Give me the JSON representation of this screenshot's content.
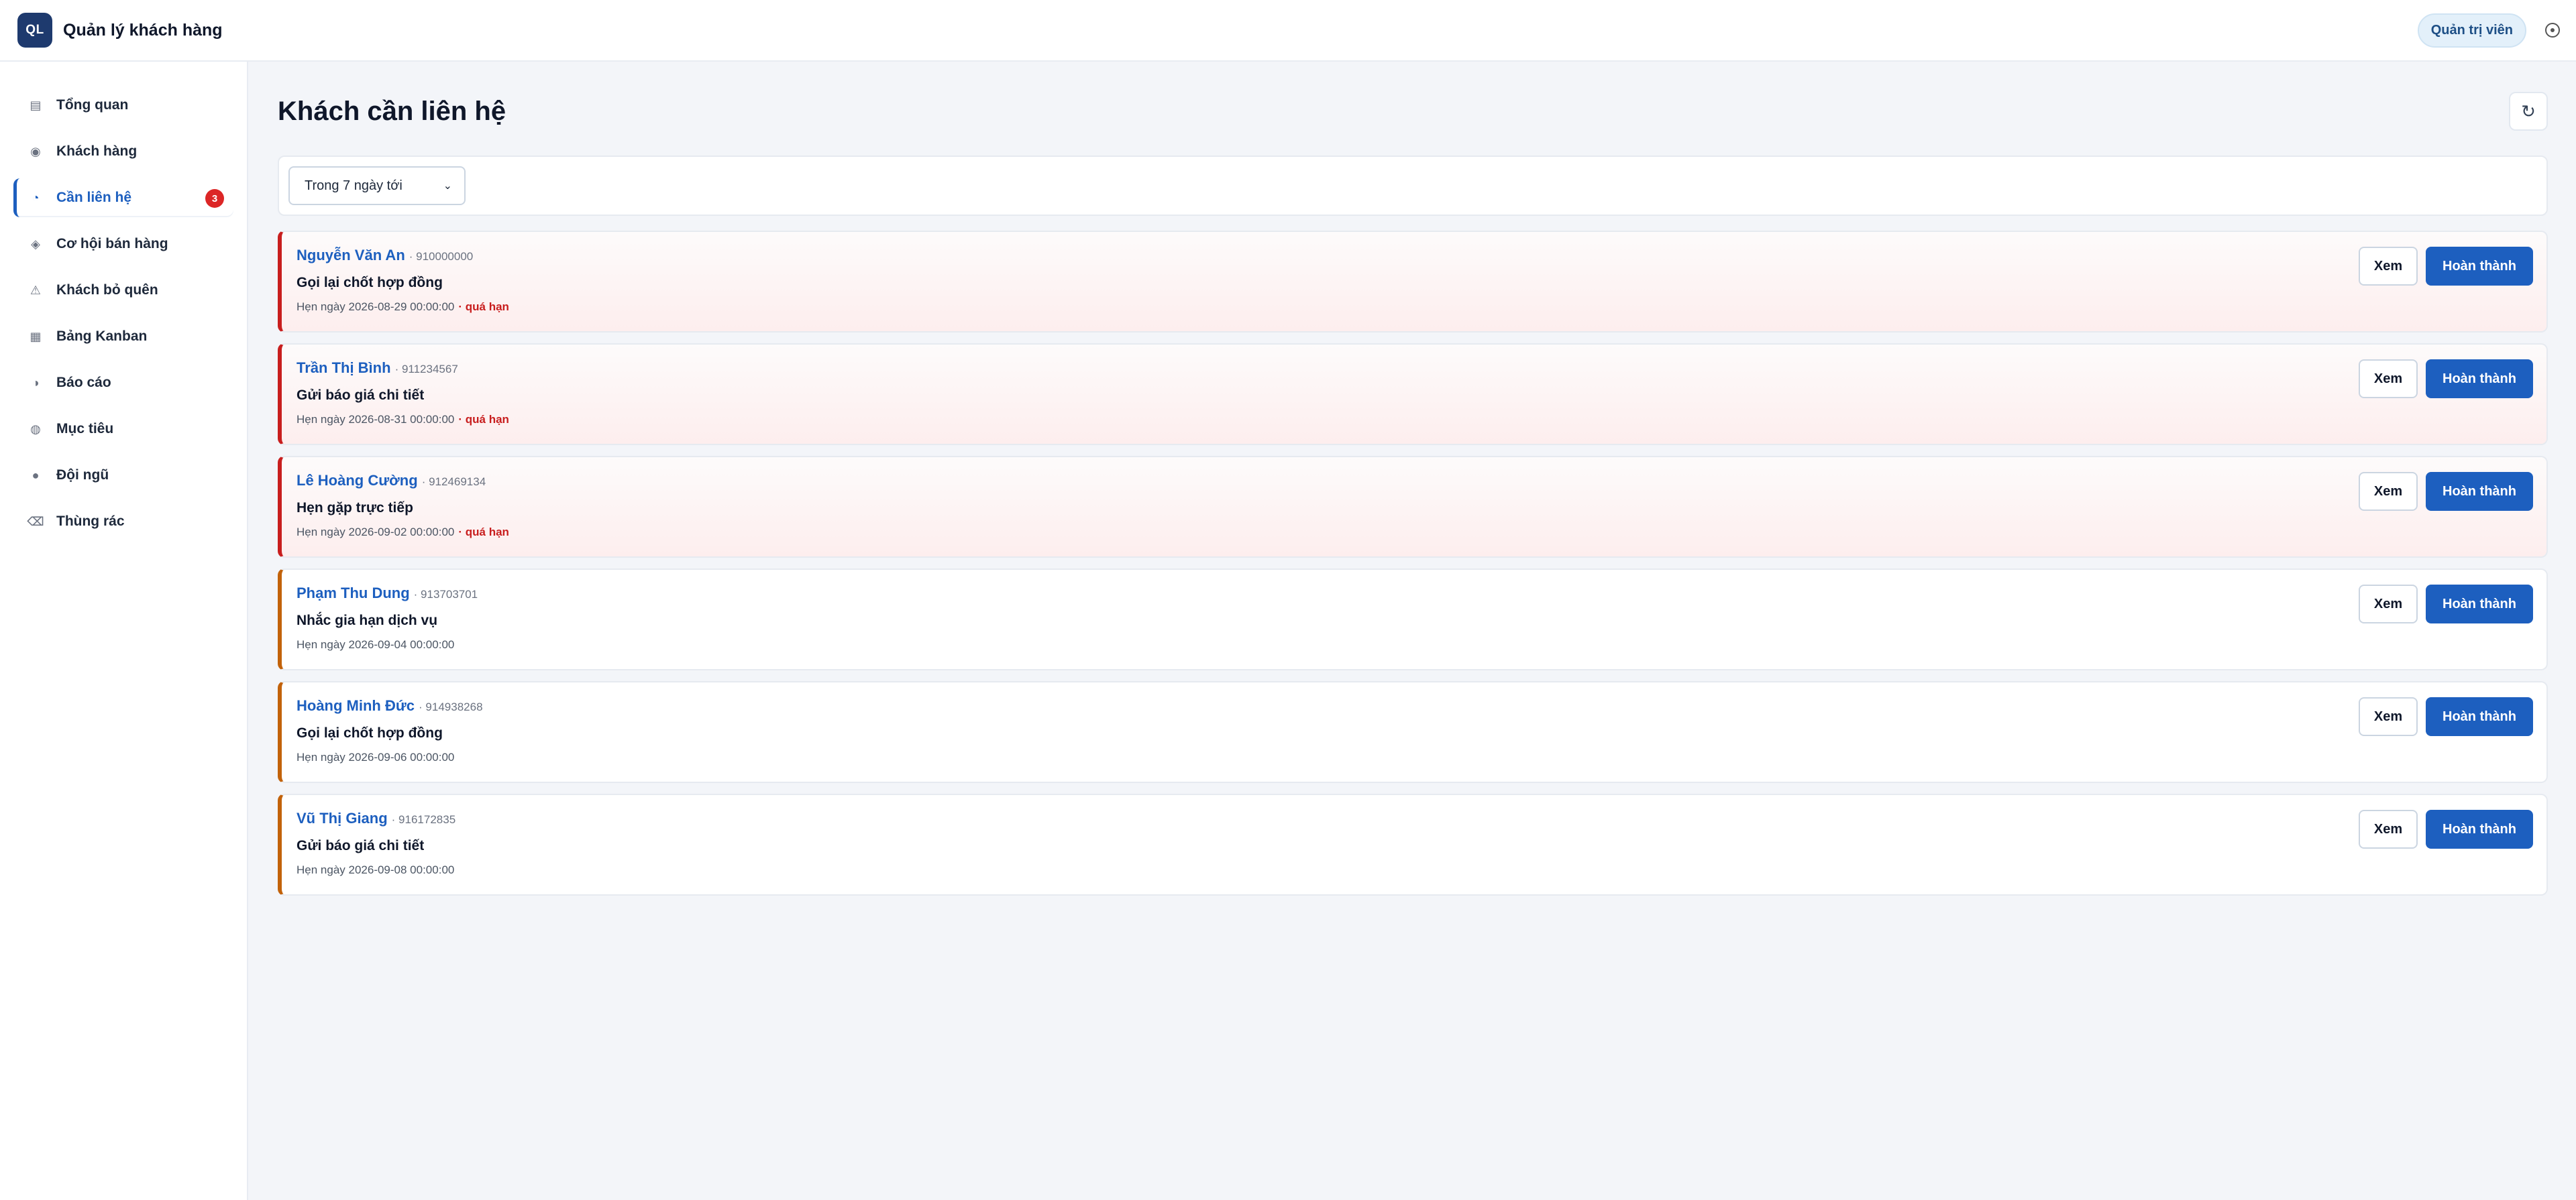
{
  "app": {
    "logo_text": "QL",
    "title": "Quản lý khách hàng",
    "role": "Quản trị viên",
    "settings_icon": "circle-dot-icon"
  },
  "sidebar": {
    "items": [
      {
        "label": "Tổng quan",
        "icon": "dashboard-icon",
        "active": false
      },
      {
        "label": "Khách hàng",
        "icon": "users-icon",
        "active": false
      },
      {
        "label": "Cần liên hệ",
        "icon": "clock-icon",
        "active": true,
        "badge": "3"
      },
      {
        "label": "Cơ hội bán hàng",
        "icon": "diamond-icon",
        "active": false
      },
      {
        "label": "Khách bỏ quên",
        "icon": "warning-icon",
        "active": false
      },
      {
        "label": "Bảng Kanban",
        "icon": "board-icon",
        "active": false
      },
      {
        "label": "Báo cáo",
        "icon": "report-icon",
        "active": false
      },
      {
        "label": "Mục tiêu",
        "icon": "target-icon",
        "active": false
      },
      {
        "label": "Đội ngũ",
        "icon": "team-icon",
        "active": false
      },
      {
        "label": "Thùng rác",
        "icon": "trash-icon",
        "active": false
      }
    ]
  },
  "main": {
    "page_title": "Khách cần liên hệ",
    "refresh_icon": "refresh-icon",
    "filter": {
      "selected": "Trong 7 ngày tới"
    },
    "buttons": {
      "view": "Xem",
      "done": "Hoàn thành"
    },
    "tasks": [
      {
        "name": "Nguyễn Văn An",
        "phone": "· 910000000",
        "task": "Gọi lại chốt hợp đồng",
        "due": "Hẹn ngày 2026-08-29 00:00:00",
        "overdue": "· quá hạn",
        "status": "overdue"
      },
      {
        "name": "Trần Thị Bình",
        "phone": "· 911234567",
        "task": "Gửi báo giá chi tiết",
        "due": "Hẹn ngày 2026-08-31 00:00:00",
        "overdue": "· quá hạn",
        "status": "overdue"
      },
      {
        "name": "Lê Hoàng Cường",
        "phone": "· 912469134",
        "task": "Hẹn gặp trực tiếp",
        "due": "Hẹn ngày 2026-09-02 00:00:00",
        "overdue": "· quá hạn",
        "status": "overdue"
      },
      {
        "name": "Phạm Thu Dung",
        "phone": "· 913703701",
        "task": "Nhắc gia hạn dịch vụ",
        "due": "Hẹn ngày 2026-09-04 00:00:00",
        "overdue": "",
        "status": "upcoming"
      },
      {
        "name": "Hoàng Minh Đức",
        "phone": "· 914938268",
        "task": "Gọi lại chốt hợp đồng",
        "due": "Hẹn ngày 2026-09-06 00:00:00",
        "overdue": "",
        "status": "upcoming"
      },
      {
        "name": "Vũ Thị Giang",
        "phone": "· 916172835",
        "task": "Gửi báo giá chi tiết",
        "due": "Hẹn ngày 2026-09-08 00:00:00",
        "overdue": "",
        "status": "upcoming"
      }
    ]
  },
  "colors": {
    "accent": "#1d5fbf",
    "overdue": "#c81e1e",
    "upcoming": "#c2620a",
    "logo_bg": "#1e3a6e"
  }
}
